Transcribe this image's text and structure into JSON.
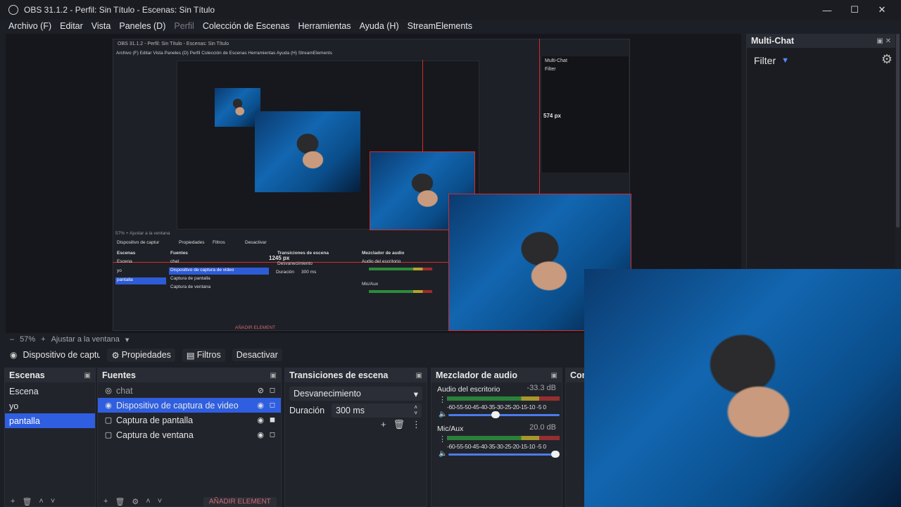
{
  "window": {
    "title": "OBS 31.1.2 - Perfil: Sin Título - Escenas: Sin Título"
  },
  "menu": [
    {
      "label": "Archivo (F)",
      "enabled": true
    },
    {
      "label": "Editar",
      "enabled": true
    },
    {
      "label": "Vista",
      "enabled": true
    },
    {
      "label": "Paneles (D)",
      "enabled": true
    },
    {
      "label": "Perfil",
      "enabled": false
    },
    {
      "label": "Colección de Escenas",
      "enabled": true
    },
    {
      "label": "Herramientas",
      "enabled": true
    },
    {
      "label": "Ayuda (H)",
      "enabled": true
    },
    {
      "label": "StreamElements",
      "enabled": true
    }
  ],
  "preview": {
    "nested_title": "OBS 31.1.2 - Perfil: Sin Título - Escenas: Sin Título",
    "nested_menu": "Archivo (F)  Editar  Vista  Paneles (D)  Perfil  Colección de Escenas  Herramientas  Ayuda (H)  StreamElements",
    "nested_multichat": "Multi-Chat",
    "nested_filter": "Filter",
    "height_label": "574 px",
    "width_label": "1245 px",
    "nested_zoom": "57%  +  Ajustar a la ventana",
    "nested_source": "Dispositivo de captur",
    "nested_props": "Propiedades",
    "nested_filters": "Filtros",
    "nested_deactivate": "Desactivar",
    "nested_scenes_hdr": "Escenas",
    "nested_sources_hdr": "Fuentes",
    "nested_trans_hdr": "Transiciones de escena",
    "nested_mixer_hdr": "Mezclador de audio",
    "nested_scenes": [
      "Escena",
      "yo",
      "pantalla"
    ],
    "nested_sources": [
      "chat",
      "Dispositivo de captura de video",
      "Captura de pantalla",
      "Captura de ventana"
    ],
    "nested_transition": "Desvanecimiento",
    "nested_duration": "Duración",
    "nested_duration_val": "300 ms",
    "nested_ch1": "Audio del escritorio",
    "nested_ch2": "Mic/Aux",
    "nested_add": "AÑADIR ELEMENT"
  },
  "zoom": {
    "percent": "57%",
    "plus": "+",
    "fit": "Ajustar a la ventana"
  },
  "source_toolbar": {
    "source_name": "Dispositivo de captur",
    "properties": "Propiedades",
    "filters": "Filtros",
    "deactivate": "Desactivar"
  },
  "scenes": {
    "header": "Escenas",
    "items": [
      {
        "label": "Escena",
        "selected": false
      },
      {
        "label": "yo",
        "selected": false
      },
      {
        "label": "pantalla",
        "selected": true
      }
    ]
  },
  "sources": {
    "header": "Fuentes",
    "items": [
      {
        "label": "chat",
        "selected": false,
        "visible": false
      },
      {
        "label": "Dispositivo de captura de video",
        "selected": true,
        "visible": true
      },
      {
        "label": "Captura de pantalla",
        "selected": false,
        "visible": true
      },
      {
        "label": "Captura de ventana",
        "selected": false,
        "visible": true
      }
    ],
    "add_label": "AÑADIR ELEMENT"
  },
  "transitions": {
    "header": "Transiciones de escena",
    "selected": "Desvanecimiento",
    "duration_label": "Duración",
    "duration_value": "300 ms"
  },
  "mixer": {
    "header": "Mezclador de audio",
    "scale": "-60-55-50-45-40-35-30-25-20-15-10 -5  0",
    "channels": [
      {
        "name": "Audio del escritorio",
        "db": "-33.3 dB",
        "volume": 0.42
      },
      {
        "name": "Mic/Aux",
        "db": "20.0 dB",
        "volume": 1.0
      }
    ]
  },
  "controls": {
    "header_partial": "Con"
  },
  "multichat": {
    "title": "Multi-Chat",
    "filter_label": "Filter"
  },
  "icons": {
    "obs": "obs-logo-icon",
    "minimize": "minimize-icon",
    "maximize": "maximize-icon",
    "close": "close-icon",
    "gear": "gear-icon",
    "eye": "eye-icon",
    "lock": "lock-icon"
  },
  "colors": {
    "accent": "#2f5fe0",
    "guide": "#d62a2a",
    "background": "#1d1f26"
  }
}
